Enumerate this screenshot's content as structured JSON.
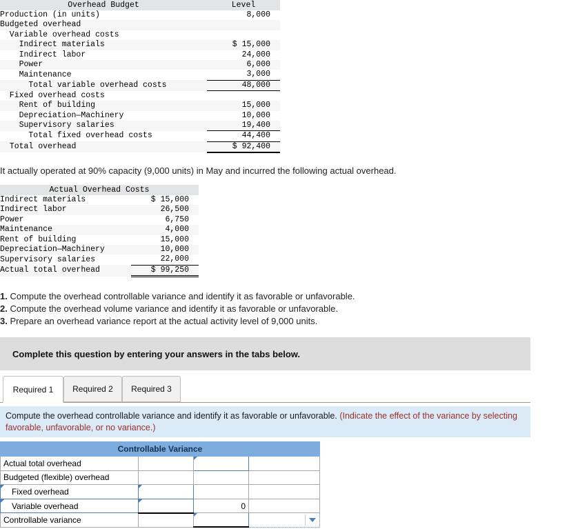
{
  "budget_table": {
    "title": "Overhead Budget",
    "level_header": "Level",
    "rows": [
      {
        "label": "Production (in units)",
        "value": "8,000"
      },
      {
        "label": "Budgeted overhead",
        "value": ""
      },
      {
        "label": "  Variable overhead costs",
        "value": ""
      },
      {
        "label": "    Indirect materials",
        "value": "$ 15,000"
      },
      {
        "label": "    Indirect labor",
        "value": "24,000"
      },
      {
        "label": "    Power",
        "value": "6,000"
      },
      {
        "label": "    Maintenance",
        "value": "3,000"
      },
      {
        "label": "      Total variable overhead costs",
        "value": "48,000"
      },
      {
        "label": "  Fixed overhead costs",
        "value": ""
      },
      {
        "label": "    Rent of building",
        "value": "15,000"
      },
      {
        "label": "    Depreciation—Machinery",
        "value": "10,000"
      },
      {
        "label": "    Supervisory salaries",
        "value": "19,400"
      },
      {
        "label": "      Total fixed overhead costs",
        "value": "44,400"
      },
      {
        "label": "  Total overhead",
        "value": "$ 92,400"
      }
    ]
  },
  "intro_line": "It actually operated at 90% capacity (9,000 units) in May and incurred the following actual overhead.",
  "actual_table": {
    "title": "Actual Overhead Costs",
    "rows": [
      {
        "label": "Indirect materials",
        "value": "$ 15,000"
      },
      {
        "label": "Indirect labor",
        "value": "26,500"
      },
      {
        "label": "Power",
        "value": "6,750"
      },
      {
        "label": "Maintenance",
        "value": "4,000"
      },
      {
        "label": "Rent of building",
        "value": "15,000"
      },
      {
        "label": "Depreciation—Machinery",
        "value": "10,000"
      },
      {
        "label": "Supervisory salaries",
        "value": "22,000"
      },
      {
        "label": "Actual total overhead",
        "value": "$ 99,250"
      }
    ]
  },
  "requirements": [
    {
      "num": "1.",
      "text": " Compute the overhead controllable variance and identify it as favorable or unfavorable."
    },
    {
      "num": "2.",
      "text": " Compute the overhead volume variance and identify it as favorable or unfavorable."
    },
    {
      "num": "3.",
      "text": " Prepare an overhead variance report at the actual activity level of 9,000 units."
    }
  ],
  "instruction_banner": "Complete this question by entering your answers in the tabs below.",
  "tabs": [
    {
      "label": "Required 1",
      "active": true
    },
    {
      "label": "Required 2",
      "active": false
    },
    {
      "label": "Required 3",
      "active": false
    }
  ],
  "question_panel": {
    "main": "Compute the overhead controllable variance and identify it as favorable or unfavorable.",
    "hint": "(Indicate the effect of the variance by selecting favorable, unfavorable, or no variance.)"
  },
  "answer_table": {
    "title": "Controllable Variance",
    "rows": [
      {
        "label": "Actual total overhead",
        "indent": false,
        "col2": "",
        "col3": "",
        "col4": ""
      },
      {
        "label": "Budgeted (flexible) overhead",
        "indent": false,
        "col2": "",
        "col3": "",
        "col4": ""
      },
      {
        "label": "Fixed overhead",
        "indent": true,
        "col2": "",
        "col3": "",
        "col4": ""
      },
      {
        "label": "Variable overhead",
        "indent": true,
        "col2": "",
        "col3": "0",
        "col4": ""
      },
      {
        "label": "Controllable variance",
        "indent": false,
        "col2": "",
        "col3": "",
        "col4": ""
      }
    ],
    "dropdown_value": ""
  },
  "colors": {
    "table_header_gray": "#e3e4e6",
    "banner_gray": "#dddddd",
    "panel_blue": "#daeaf7",
    "answer_title_blue": "#7cadde",
    "hint_red": "#9c2e2b",
    "input_border_blue": "#4a7ebb"
  }
}
